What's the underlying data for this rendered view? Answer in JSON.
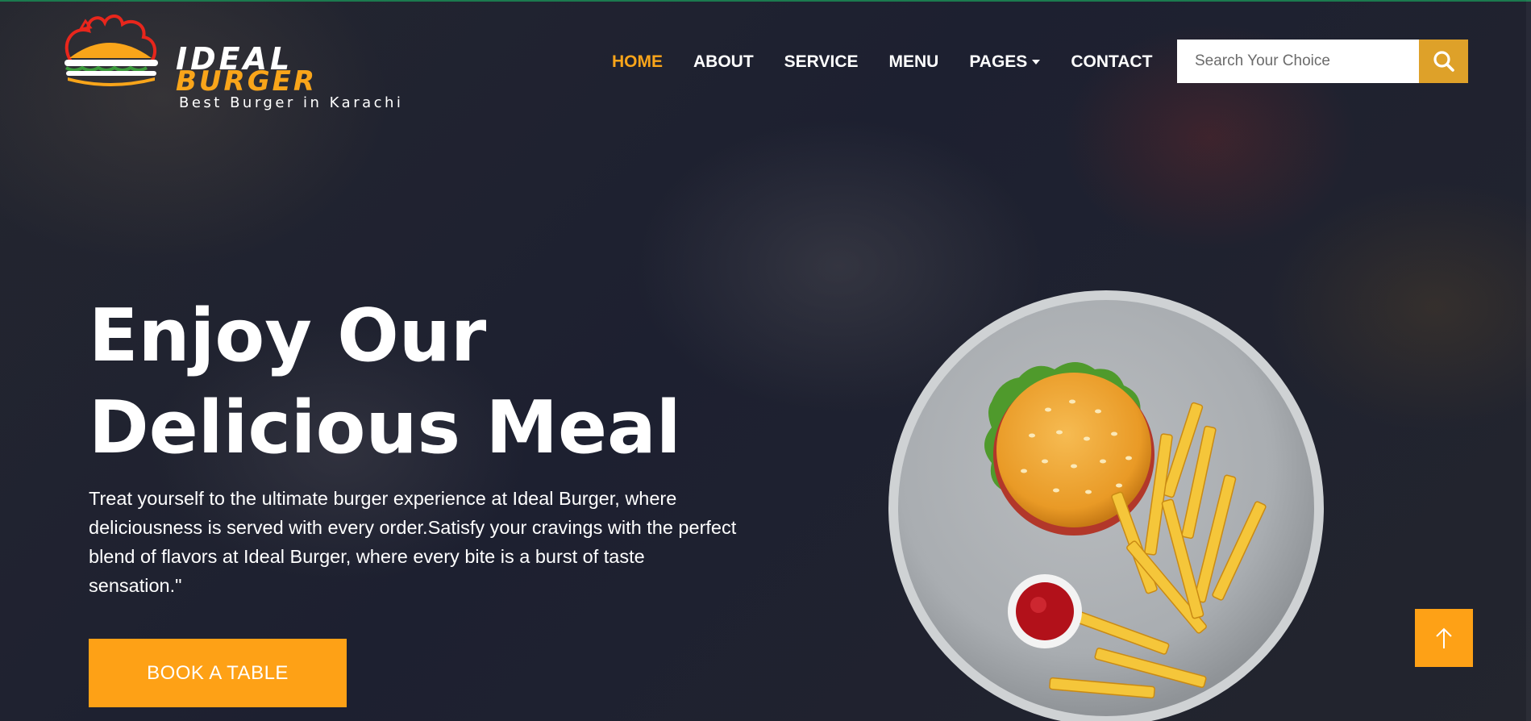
{
  "logo": {
    "word1": "IDEAL",
    "word2": "BURGER",
    "tagline": "Best Burger in Karachi",
    "icon": "burger-logo-icon"
  },
  "nav": {
    "items": [
      {
        "label": "HOME",
        "active": true
      },
      {
        "label": "ABOUT",
        "active": false
      },
      {
        "label": "SERVICE",
        "active": false
      },
      {
        "label": "MENU",
        "active": false
      },
      {
        "label": "PAGES",
        "active": false,
        "dropdown": true
      },
      {
        "label": "CONTACT",
        "active": false
      }
    ]
  },
  "search": {
    "placeholder": "Search Your Choice",
    "value": "",
    "icon": "search-icon"
  },
  "hero": {
    "title_line1": "Enjoy Our",
    "title_line2": "Delicious Meal",
    "description": "Treat yourself to the ultimate burger experience at Ideal Burger, where deliciousness is served with every order.Satisfy your cravings with the perfect blend of flavors at Ideal Burger, where every bite is a burst of taste sensation.\"",
    "cta_label": "BOOK A TABLE",
    "image_icon": "burger-fries-plate-icon"
  },
  "back_to_top": {
    "icon": "arrow-up-icon"
  },
  "colors": {
    "accent": "#fea116",
    "nav_active": "#f9a51a",
    "search_button": "#dea129",
    "background": "#1e2130"
  }
}
